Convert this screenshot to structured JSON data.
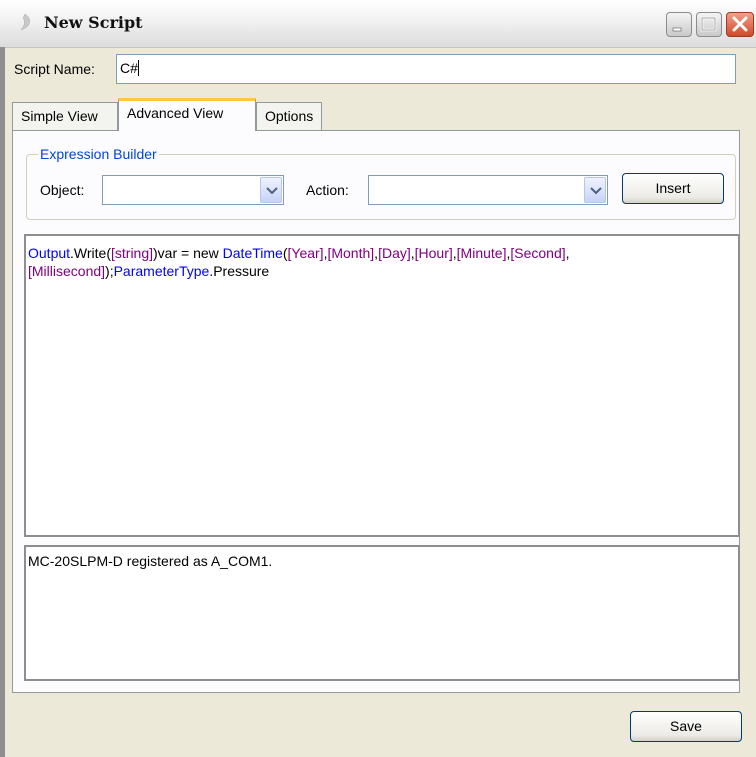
{
  "window": {
    "title": "New Script",
    "controls": [
      "minimize",
      "maximize",
      "close"
    ]
  },
  "script_name": {
    "label": "Script Name:",
    "value": "C#"
  },
  "tabs": [
    {
      "label": "Simple View",
      "active": false
    },
    {
      "label": "Advanced View",
      "active": true
    },
    {
      "label": "Options",
      "active": false
    }
  ],
  "expression_builder": {
    "legend": "Expression Builder",
    "object_label": "Object:",
    "object_value": "",
    "action_label": "Action:",
    "action_value": "",
    "insert_label": "Insert"
  },
  "code": {
    "tokens": [
      {
        "text": "Output",
        "color": "blue"
      },
      {
        "text": ".Write(",
        "color": "black"
      },
      {
        "text": "[string]",
        "color": "purple"
      },
      {
        "text": ")var = new ",
        "color": "black"
      },
      {
        "text": "DateTime",
        "color": "blue"
      },
      {
        "text": "(",
        "color": "black"
      },
      {
        "text": "[Year]",
        "color": "purple"
      },
      {
        "text": ",",
        "color": "black"
      },
      {
        "text": "[Month]",
        "color": "purple"
      },
      {
        "text": ",",
        "color": "black"
      },
      {
        "text": "[Day]",
        "color": "purple"
      },
      {
        "text": ",",
        "color": "black"
      },
      {
        "text": "[Hour]",
        "color": "purple"
      },
      {
        "text": ",",
        "color": "black"
      },
      {
        "text": "[Minute]",
        "color": "purple"
      },
      {
        "text": ",",
        "color": "black"
      },
      {
        "text": "[Second]",
        "color": "purple"
      },
      {
        "text": ",",
        "color": "black"
      },
      {
        "text": "[Millisecond]",
        "color": "purple"
      },
      {
        "text": ");",
        "color": "black"
      },
      {
        "text": "ParameterType",
        "color": "blue"
      },
      {
        "text": ".Pressure",
        "color": "black"
      }
    ]
  },
  "output": {
    "text": "MC-20SLPM-D registered as A_COM1."
  },
  "footer": {
    "save_label": "Save"
  },
  "colors": {
    "keyword_blue": "#0000ff",
    "keyword_purple": "#800080",
    "group_legend": "#0046d5",
    "active_tab_accent": "#ffc83c"
  }
}
